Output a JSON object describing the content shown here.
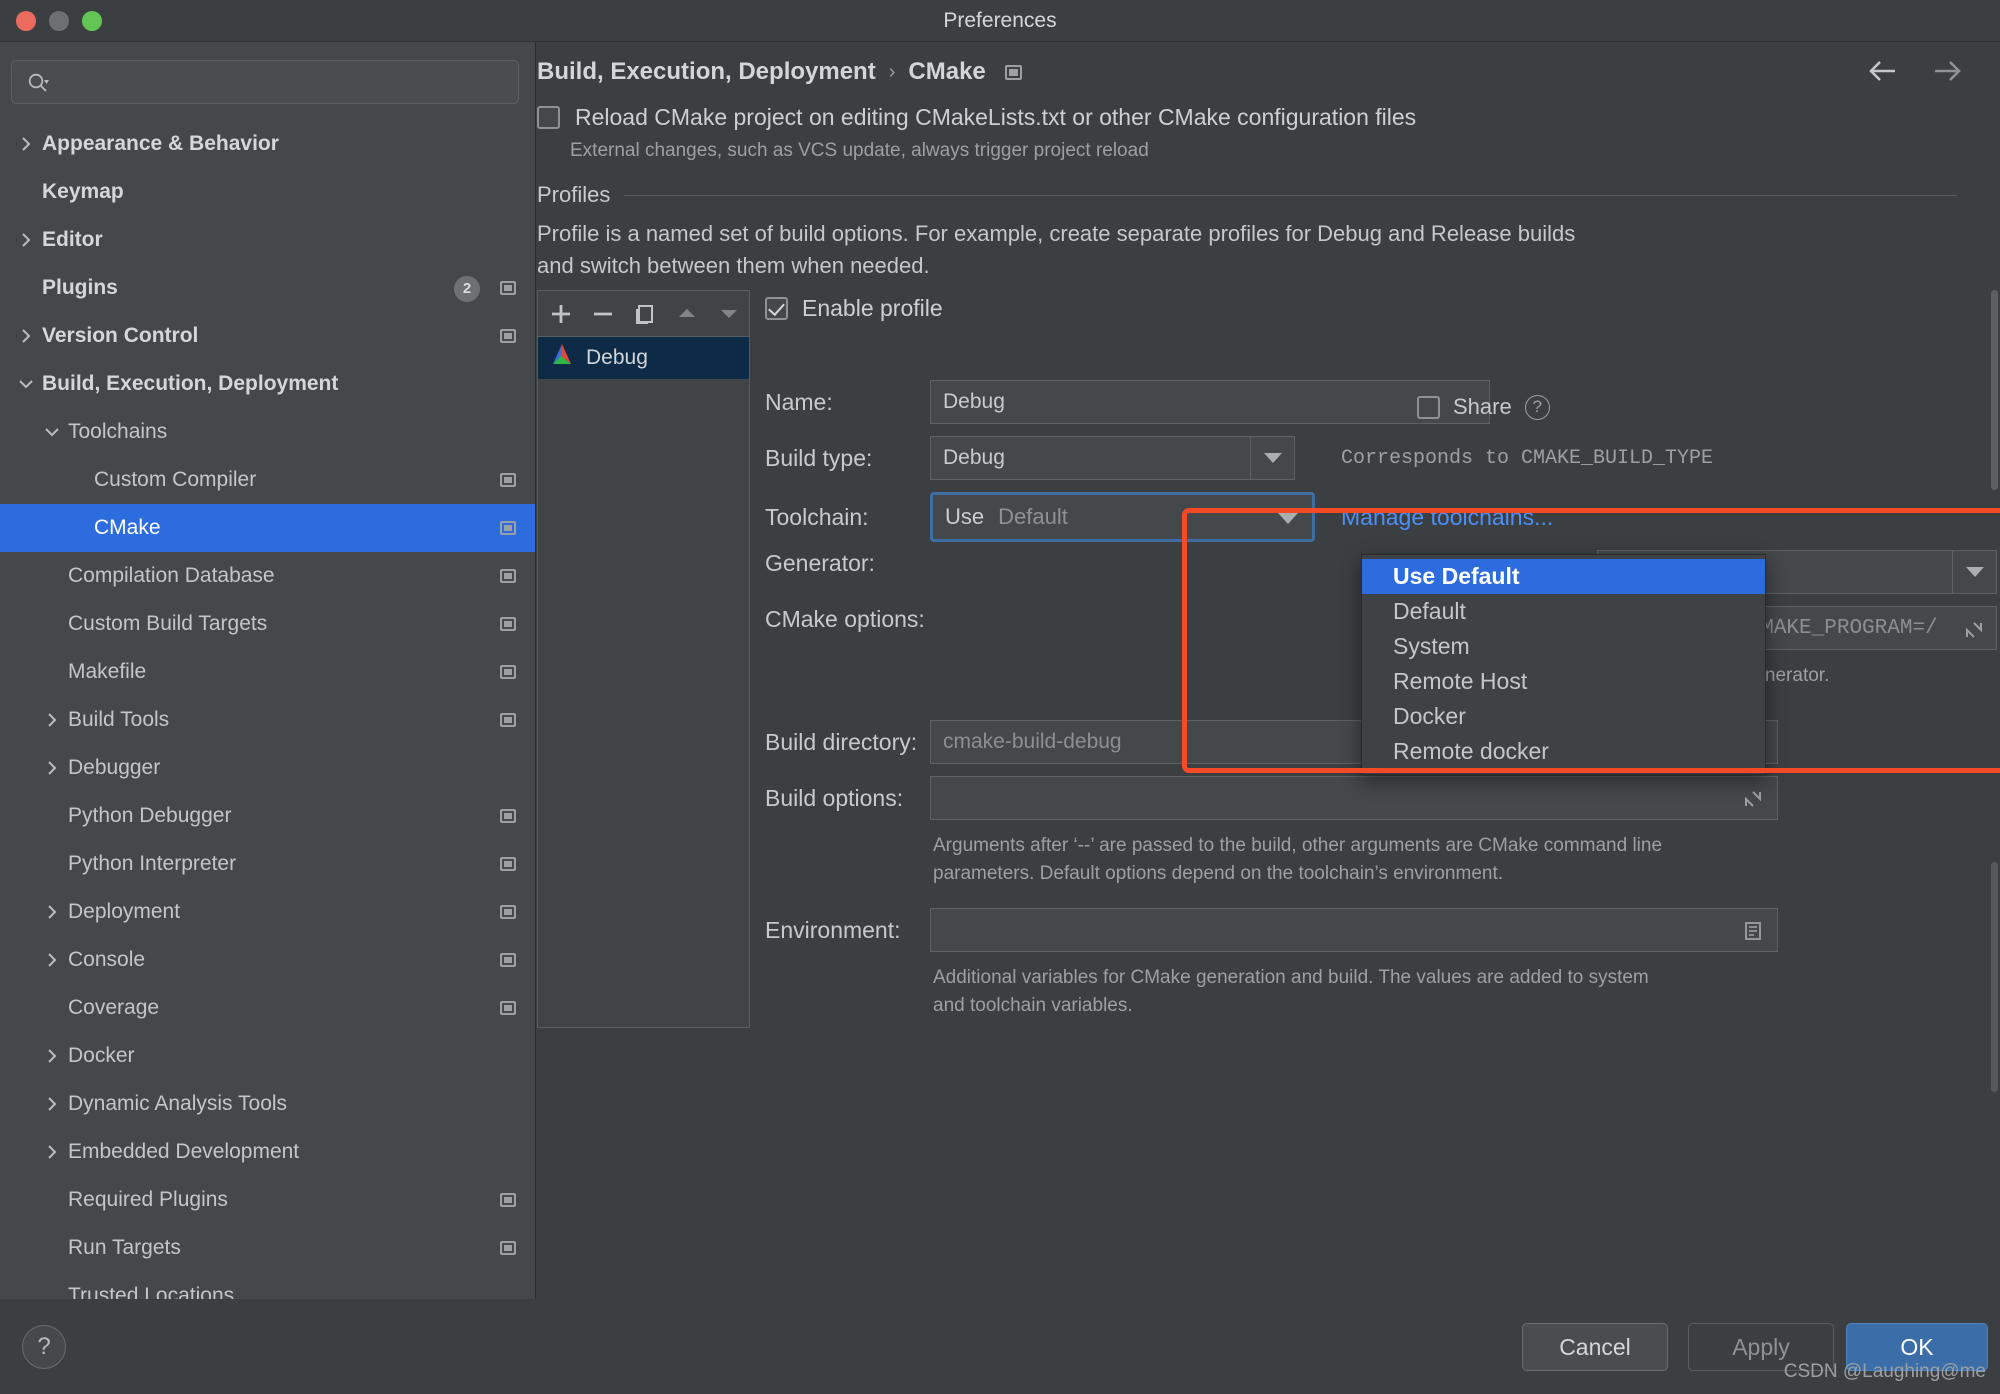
{
  "window": {
    "title": "Preferences"
  },
  "search": {
    "placeholder": "",
    "value": "",
    "icon": "search-icon"
  },
  "sidebar": {
    "items": [
      {
        "label": "Appearance & Behavior",
        "indent": 0,
        "twisty": "right",
        "bold": true,
        "badge": null,
        "proj": false,
        "selected": false
      },
      {
        "label": "Keymap",
        "indent": 0,
        "twisty": "none",
        "bold": true,
        "badge": null,
        "proj": false,
        "selected": false
      },
      {
        "label": "Editor",
        "indent": 0,
        "twisty": "right",
        "bold": true,
        "badge": null,
        "proj": false,
        "selected": false
      },
      {
        "label": "Plugins",
        "indent": 0,
        "twisty": "none",
        "bold": true,
        "badge": "2",
        "proj": true,
        "selected": false
      },
      {
        "label": "Version Control",
        "indent": 0,
        "twisty": "right",
        "bold": true,
        "badge": null,
        "proj": true,
        "selected": false
      },
      {
        "label": "Build, Execution, Deployment",
        "indent": 0,
        "twisty": "down",
        "bold": true,
        "badge": null,
        "proj": false,
        "selected": false
      },
      {
        "label": "Toolchains",
        "indent": 1,
        "twisty": "down",
        "bold": false,
        "badge": null,
        "proj": false,
        "selected": false
      },
      {
        "label": "Custom Compiler",
        "indent": 2,
        "twisty": "none",
        "bold": false,
        "badge": null,
        "proj": true,
        "selected": false
      },
      {
        "label": "CMake",
        "indent": 2,
        "twisty": "none",
        "bold": false,
        "badge": null,
        "proj": true,
        "selected": true
      },
      {
        "label": "Compilation Database",
        "indent": 1,
        "twisty": "none",
        "bold": false,
        "badge": null,
        "proj": true,
        "selected": false
      },
      {
        "label": "Custom Build Targets",
        "indent": 1,
        "twisty": "none",
        "bold": false,
        "badge": null,
        "proj": true,
        "selected": false
      },
      {
        "label": "Makefile",
        "indent": 1,
        "twisty": "none",
        "bold": false,
        "badge": null,
        "proj": true,
        "selected": false
      },
      {
        "label": "Build Tools",
        "indent": 1,
        "twisty": "right",
        "bold": false,
        "badge": null,
        "proj": true,
        "selected": false
      },
      {
        "label": "Debugger",
        "indent": 1,
        "twisty": "right",
        "bold": false,
        "badge": null,
        "proj": false,
        "selected": false
      },
      {
        "label": "Python Debugger",
        "indent": 1,
        "twisty": "none",
        "bold": false,
        "badge": null,
        "proj": true,
        "selected": false
      },
      {
        "label": "Python Interpreter",
        "indent": 1,
        "twisty": "none",
        "bold": false,
        "badge": null,
        "proj": true,
        "selected": false
      },
      {
        "label": "Deployment",
        "indent": 1,
        "twisty": "right",
        "bold": false,
        "badge": null,
        "proj": true,
        "selected": false
      },
      {
        "label": "Console",
        "indent": 1,
        "twisty": "right",
        "bold": false,
        "badge": null,
        "proj": true,
        "selected": false
      },
      {
        "label": "Coverage",
        "indent": 1,
        "twisty": "none",
        "bold": false,
        "badge": null,
        "proj": true,
        "selected": false
      },
      {
        "label": "Docker",
        "indent": 1,
        "twisty": "right",
        "bold": false,
        "badge": null,
        "proj": false,
        "selected": false
      },
      {
        "label": "Dynamic Analysis Tools",
        "indent": 1,
        "twisty": "right",
        "bold": false,
        "badge": null,
        "proj": false,
        "selected": false
      },
      {
        "label": "Embedded Development",
        "indent": 1,
        "twisty": "right",
        "bold": false,
        "badge": null,
        "proj": false,
        "selected": false
      },
      {
        "label": "Required Plugins",
        "indent": 1,
        "twisty": "none",
        "bold": false,
        "badge": null,
        "proj": true,
        "selected": false
      },
      {
        "label": "Run Targets",
        "indent": 1,
        "twisty": "none",
        "bold": false,
        "badge": null,
        "proj": true,
        "selected": false
      },
      {
        "label": "Trusted Locations",
        "indent": 1,
        "twisty": "none",
        "bold": false,
        "badge": null,
        "proj": false,
        "selected": false
      }
    ],
    "help_label": "?"
  },
  "main": {
    "breadcrumb": {
      "root": "Build, Execution, Deployment",
      "separator": "›",
      "leaf": "CMake"
    },
    "reload": {
      "label": "Reload CMake project on editing CMakeLists.txt or other CMake configuration files",
      "sub": "External changes, such as VCS update, always trigger project reload",
      "checked": false
    },
    "profiles": {
      "section_label": "Profiles",
      "description": "Profile is a named set of build options. For example, create separate profiles for Debug and Release builds and switch between them when needed.",
      "toolbar": [
        "add-icon",
        "remove-icon",
        "copy-icon",
        "move-up-icon",
        "move-down-icon"
      ],
      "items": [
        {
          "label": "Debug",
          "selected": true
        }
      ]
    },
    "form": {
      "enable_profile": {
        "label": "Enable profile",
        "checked": true
      },
      "name": {
        "label": "Name:",
        "value": "Debug"
      },
      "share": {
        "label": "Share",
        "checked": false,
        "help": "?"
      },
      "build_type": {
        "label": "Build type:",
        "value": "Debug",
        "hint": "Corresponds to CMAKE_BUILD_TYPE"
      },
      "toolchain": {
        "label": "Toolchain:",
        "value_prefix": "Use",
        "value_suffix": "Default",
        "link": "Manage toolchains...",
        "options": [
          {
            "label": "Use  Default",
            "selected": true
          },
          {
            "label": "Default",
            "selected": false
          },
          {
            "label": "System",
            "selected": false
          },
          {
            "label": "Remote Host",
            "selected": false
          },
          {
            "label": "Docker",
            "selected": false
          },
          {
            "label": "Remote docker",
            "selected": false
          }
        ]
      },
      "generator": {
        "label": "Generator:",
        "value": "",
        "hint_tail": "specify a custom generator."
      },
      "cmake_options": {
        "label": "CMake options:",
        "value_tail": "ug  \"-DCMAKE_MAKE_PROGRAM=/"
      },
      "build_directory": {
        "label": "Build directory:",
        "placeholder": "cmake-build-debug"
      },
      "build_options": {
        "label": "Build options:",
        "value": "",
        "hint": "Arguments after ‘--’ are passed to the build, other arguments are CMake command line parameters. Default options depend on the toolchain’s environment."
      },
      "environment": {
        "label": "Environment:",
        "value": "",
        "hint": "Additional variables for CMake generation and build. The values are added to system and toolchain variables."
      }
    }
  },
  "footer": {
    "cancel": "Cancel",
    "apply": "Apply",
    "ok": "OK",
    "watermark": "CSDN @Laughing@me"
  },
  "colors": {
    "accent_blue": "#2d6cdf",
    "link_blue": "#4b8ff7",
    "annotation_red": "#f44a26",
    "ok_button": "#3b6ea8",
    "panel_bg": "#3c3f41",
    "sidebar_bg": "#45484a"
  }
}
